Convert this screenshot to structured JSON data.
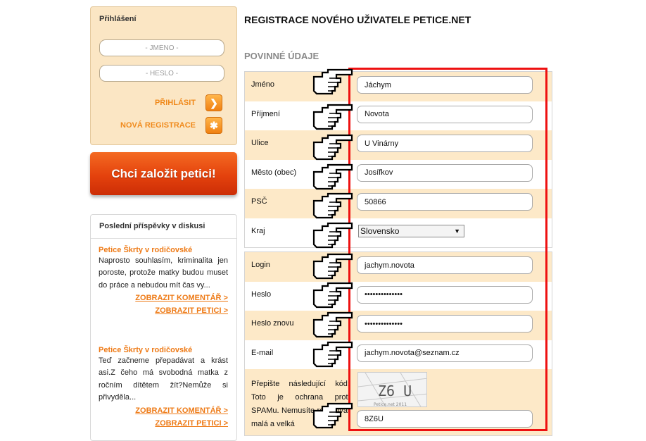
{
  "sidebar": {
    "login": {
      "title": "Přihlášení",
      "name_placeholder": "- JMÉNO -",
      "password_placeholder": "- HESLO -",
      "login_label": "PŘIHLÁSIT",
      "register_label": "NOVÁ REGISTRACE"
    },
    "petition_button": "Chci založit petici!",
    "discussion": {
      "title": "Poslední příspěvky v diskusi",
      "posts": [
        {
          "title": "Petice Škrty v rodičovské",
          "text": "Naprosto souhlasím, kriminalita jen poroste, protože matky budou muset do práce a nebudou mít čas vy...",
          "comment_link": "ZOBRAZIT KOMENTÁŘ >",
          "petition_link": "ZOBRAZIT PETICI >"
        },
        {
          "title": "Petice Škrty v rodičovské",
          "text": "Teď začneme přepadávat a krást asi.Z čeho má svobodná matka z ročním dítětem žít?Nemůže si přivyděla...",
          "comment_link": "ZOBRAZIT KOMENTÁŘ >",
          "petition_link": "ZOBRAZIT PETICI >"
        }
      ]
    }
  },
  "main": {
    "title": "REGISTRACE NOVÉHO UŽIVATELE PETICE.NET",
    "section_title": "POVINNÉ ÚDAJE",
    "personal": {
      "name_label": "Jméno",
      "name_value": "Jáchym",
      "surname_label": "Příjmení",
      "surname_value": "Novota",
      "street_label": "Ulice",
      "street_value": "U Vinárny",
      "city_label": "Město (obec)",
      "city_value": "Josífkov",
      "zip_label": "PSČ",
      "zip_value": "50866",
      "region_label": "Kraj",
      "region_value": "Slovensko"
    },
    "account": {
      "login_label": "Login",
      "login_value": "jachym.novota",
      "password_label": "Heslo",
      "password_value": "••••••••••••••",
      "password2_label": "Heslo znovu",
      "password2_value": "••••••••••••••",
      "email_label": "E-mail",
      "email_value": "jachym.novota@seznam.cz",
      "captcha_text": "Přepište následující kód: Toto je ochrana proti SPAMu. Nemusíte rozlišovat malá a velká",
      "captcha_image_text": "Z6 U",
      "captcha_image_caption": "Petice.net 2011",
      "captcha_value": "8Z6U"
    }
  },
  "colors": {
    "accent_orange": "#f08a1c",
    "highlight_frame": "#ee1111",
    "row_alt": "#fde9c8"
  }
}
